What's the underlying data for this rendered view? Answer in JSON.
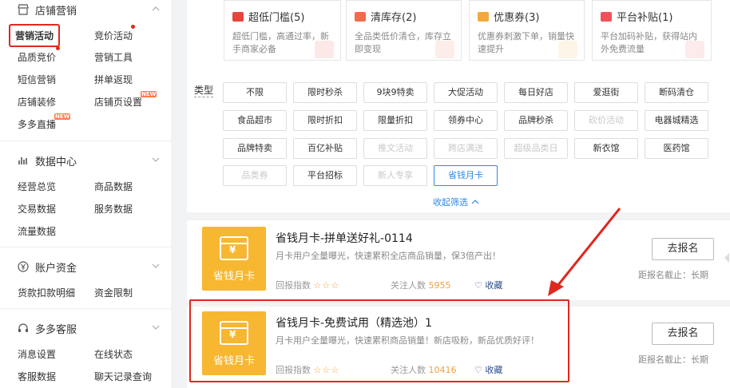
{
  "sidebar": {
    "shop_marketing": {
      "title": "店铺营销",
      "items": [
        "营销活动",
        "竞价活动",
        "品质竞价",
        "营销工具",
        "短信营销",
        "拼单返现",
        "店铺装修",
        "店铺页设置",
        "多多直播"
      ],
      "badge": "NEW"
    },
    "data_center": {
      "title": "数据中心",
      "items": [
        "经营总览",
        "商品数据",
        "交易数据",
        "服务数据",
        "流量数据"
      ]
    },
    "account_funds": {
      "title": "账户资金",
      "items": [
        "货款扣款明细",
        "资金限制"
      ]
    },
    "customer_service": {
      "title": "多多客服",
      "items": [
        "消息设置",
        "在线状态",
        "客服数据",
        "聊天记录查询"
      ]
    }
  },
  "type_cards": [
    {
      "title": "超低门槛(5)",
      "desc": "超低门槛，高通过率，新手商家必备",
      "color": "#e8453c"
    },
    {
      "title": "清库存(2)",
      "desc": "全品类低价清仓，库存立即变现",
      "color": "#f06c4a"
    },
    {
      "title": "优惠券(3)",
      "desc": "优惠券刺激下单，销量快速提升",
      "color": "#f2a93b"
    },
    {
      "title": "平台补贴(1)",
      "desc": "平台加码补贴，获得站内外免费流量",
      "color": "#f0525a"
    }
  ],
  "filter": {
    "label": "类型",
    "tags": [
      "不限",
      "限时秒杀",
      "9块9特卖",
      "大促活动",
      "每日好店",
      "爱逛街",
      "断码清仓",
      "食品超市",
      "限时折扣",
      "限量折扣",
      "领券中心",
      "品牌秒杀",
      "砍价活动",
      "电器城精选",
      "品牌特卖",
      "百亿补贴",
      "推文活动",
      "跨店满送",
      "超级品类日",
      "新衣馆",
      "医药馆",
      "品类券",
      "平台招标",
      "新人专享",
      "省钱月卡"
    ],
    "collapse": "收起筛选"
  },
  "activities": [
    {
      "image_label": "省钱月卡",
      "title": "省钱月卡-拼单送好礼-0114",
      "desc": "月卡用户全量曝光，快速累积全店商品销量，保3倍产出！",
      "rating_label": "回报指数",
      "rating": 3,
      "followers_label": "关注人数",
      "followers": "5955",
      "fav": "收藏",
      "button": "去报名",
      "deadline": "距报名截止：长期"
    },
    {
      "image_label": "省钱月卡",
      "title": "省钱月卡-免费试用（精选池）1",
      "desc": "月卡用户全量曝光，快速累积商品销量！新店吸粉，新品优质好评！",
      "rating_label": "回报指数",
      "rating": 3,
      "followers_label": "关注人数",
      "followers": "10416",
      "fav": "收藏",
      "button": "去报名",
      "deadline": "距报名截止：长期"
    }
  ],
  "colors": {
    "accent": "#e0281e",
    "link": "#2f88e6",
    "card_image": "#f7b731",
    "star": "#f2a03d"
  }
}
